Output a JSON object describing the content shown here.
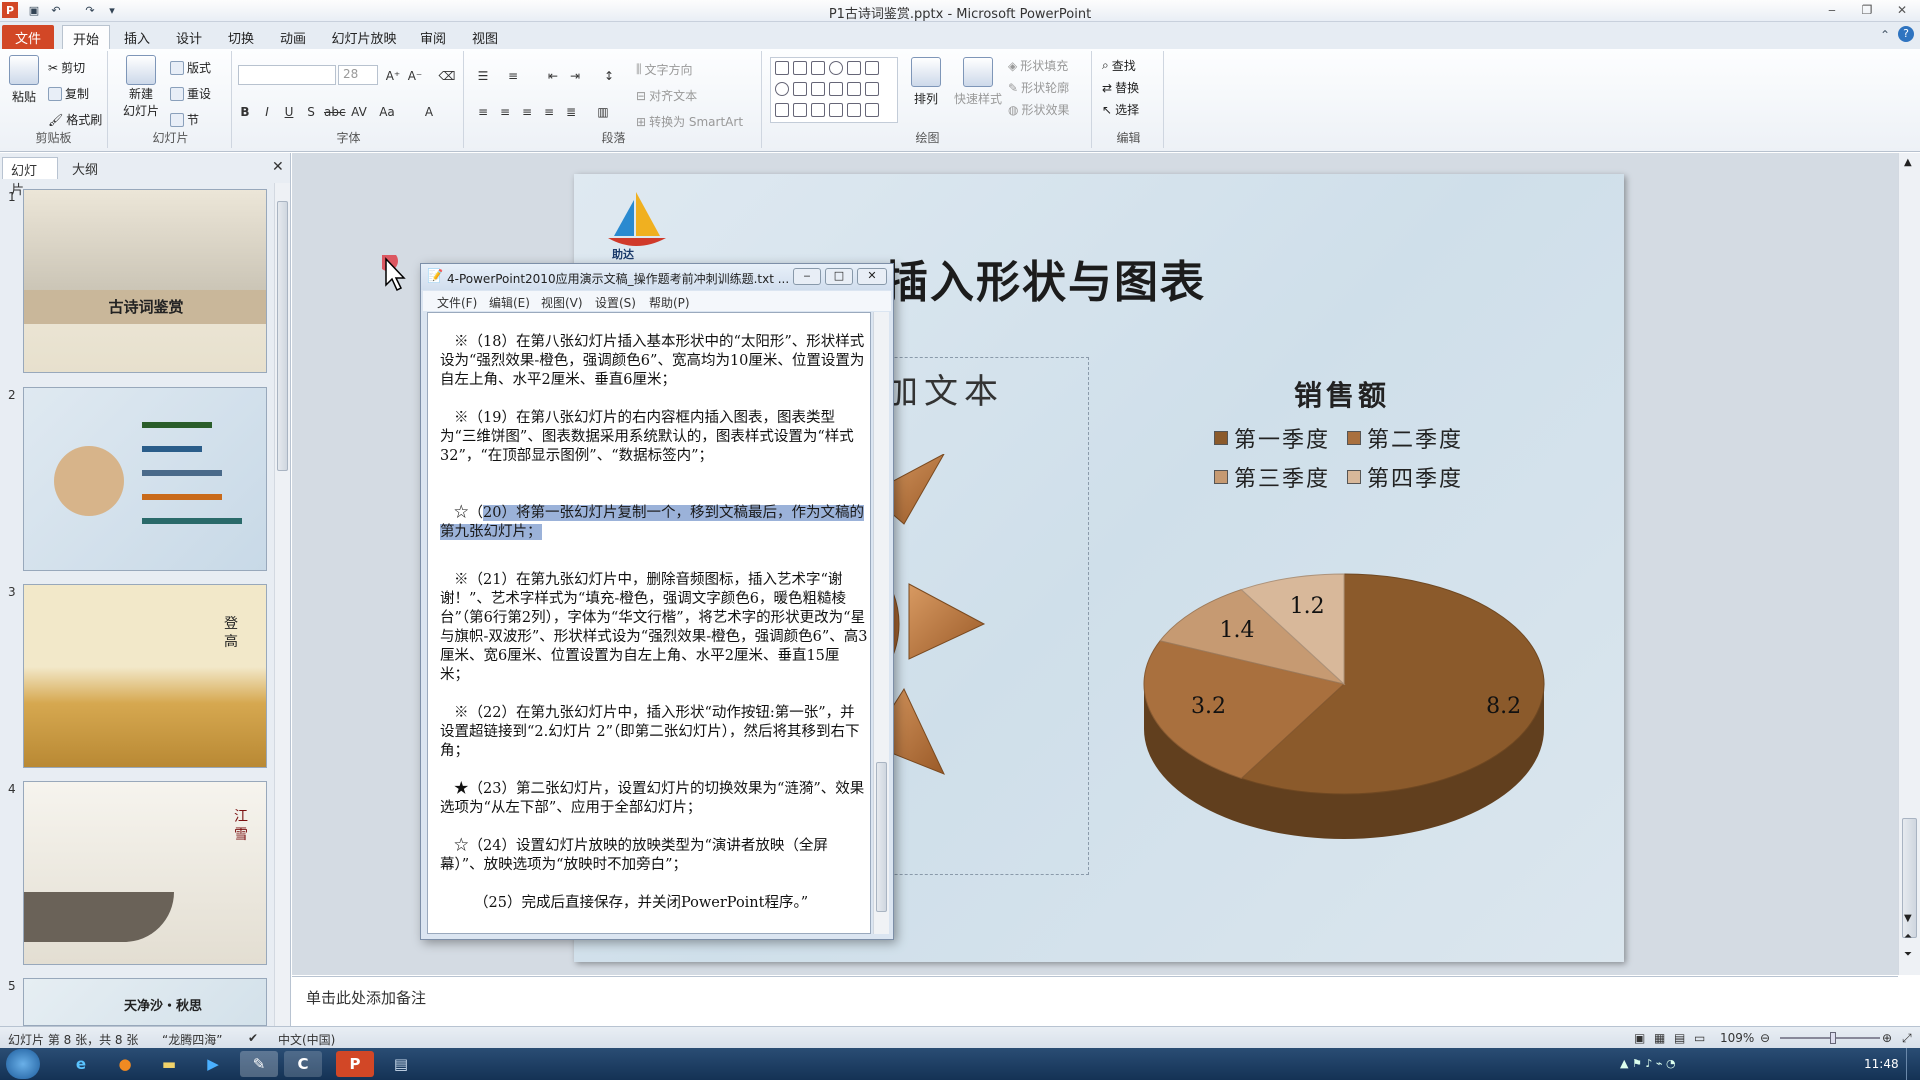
{
  "window": {
    "title": "P1古诗词鉴赏.pptx - Microsoft PowerPoint"
  },
  "tabs": [
    "文件",
    "开始",
    "插入",
    "设计",
    "切换",
    "动画",
    "幻灯片放映",
    "审阅",
    "视图"
  ],
  "ribbon": {
    "clipboard": {
      "paste": "粘贴",
      "cut": "剪切",
      "copy": "复制",
      "format_painter": "格式刷",
      "label": "剪贴板"
    },
    "slides": {
      "new_slide_line1": "新建",
      "new_slide_line2": "幻灯片",
      "layout": "版式",
      "reset": "重设",
      "section": "节",
      "label": "幻灯片"
    },
    "font": {
      "size": "28",
      "label": "字体"
    },
    "paragraph": {
      "text_direction": "文字方向",
      "align_text": "对齐文本",
      "smartart": "转换为 SmartArt",
      "label": "段落"
    },
    "drawing": {
      "arrange": "排列",
      "quick_styles": "快速样式",
      "shape_fill": "形状填充",
      "shape_outline": "形状轮廓",
      "shape_effects": "形状效果",
      "label": "绘图"
    },
    "editing": {
      "find": "查找",
      "replace": "替换",
      "select": "选择",
      "label": "编辑"
    }
  },
  "left_pane": {
    "tab_slides": "幻灯片",
    "tab_outline": "大纲",
    "thumbnails": [
      {
        "num": "1",
        "title": "古诗词鉴赏"
      },
      {
        "num": "2"
      },
      {
        "num": "3",
        "title": "登高"
      },
      {
        "num": "4",
        "title": "江雪"
      },
      {
        "num": "5",
        "title": "天净沙・秋思"
      }
    ]
  },
  "slide": {
    "title": "插入形状与图表",
    "logo_text": "助达",
    "placeholder_text": "加文本",
    "chart_title": "销售额"
  },
  "chart_data": {
    "type": "pie",
    "title": "销售额",
    "categories": [
      "第一季度",
      "第二季度",
      "第三季度",
      "第四季度"
    ],
    "values": [
      8.2,
      3.2,
      1.4,
      1.2
    ],
    "legend_position": "top",
    "style": "3d",
    "colors": [
      "#8b5a2b",
      "#a9703e",
      "#c69a72",
      "#d8b89a"
    ]
  },
  "notepad": {
    "title": "4-PowerPoint2010应用演示文稿_操作题考前冲刺训练题.txt ...",
    "menu": [
      "文件(F)",
      "编辑(E)",
      "视图(V)",
      "设置(S)",
      "帮助(P)"
    ],
    "paragraphs": [
      "※（18）在第八张幻灯片插入基本形状中的“太阳形”、形状样式设为“强烈效果-橙色，强调颜色6”、宽高均为10厘米、位置设置为自左上角、水平2厘米、垂直6厘米；",
      "※（19）在第八张幻灯片的右内容框内插入图表，图表类型为“三维饼图”、图表数据采用系统默认的，图表样式设置为“样式32”，“在顶部显示图例”、“数据标签内”；",
      "☆（",
      "20）将第一张幻灯片复制一个，移到文稿最后，作为文稿的第九张幻灯片；",
      "※（21）在第九张幻灯片中，删除音频图标，插入艺术字“谢谢！”、艺术字样式为“填充-橙色，强调文字颜色6，暖色粗糙棱台”（第6行第2列），字体为“华文行楷”，将艺术字的形状更改为“星与旗帜-双波形”、形状样式设为“强烈效果-橙色，强调颜色6”、高3厘米、宽6厘米、位置设置为自左上角、水平2厘米、垂直15厘米；",
      "※（22）在第九张幻灯片中，插入形状“动作按钮:第一张”，并设置超链接到“2.幻灯片 2”（即第二张幻灯片），然后将其移到右下角；",
      "★（23）第二张幻灯片，设置幻灯片的切换效果为“涟漪”、效果选项为“从左下部”、应用于全部幻灯片；",
      "☆（24）设置幻灯片放映的放映类型为“演讲者放映（全屏幕）”、放映选项为“放映时不加旁白”；",
      "（25）完成后直接保存，并关闭PowerPoint程序。”"
    ]
  },
  "notes": {
    "placeholder": "单击此处添加备注"
  },
  "statusbar": {
    "slide_info": "幻灯片 第 8 张，共 8 张",
    "theme": "“龙腾四海”",
    "language": "中文(中国)",
    "zoom": "109%"
  },
  "taskbar": {
    "clock": "11:48"
  }
}
